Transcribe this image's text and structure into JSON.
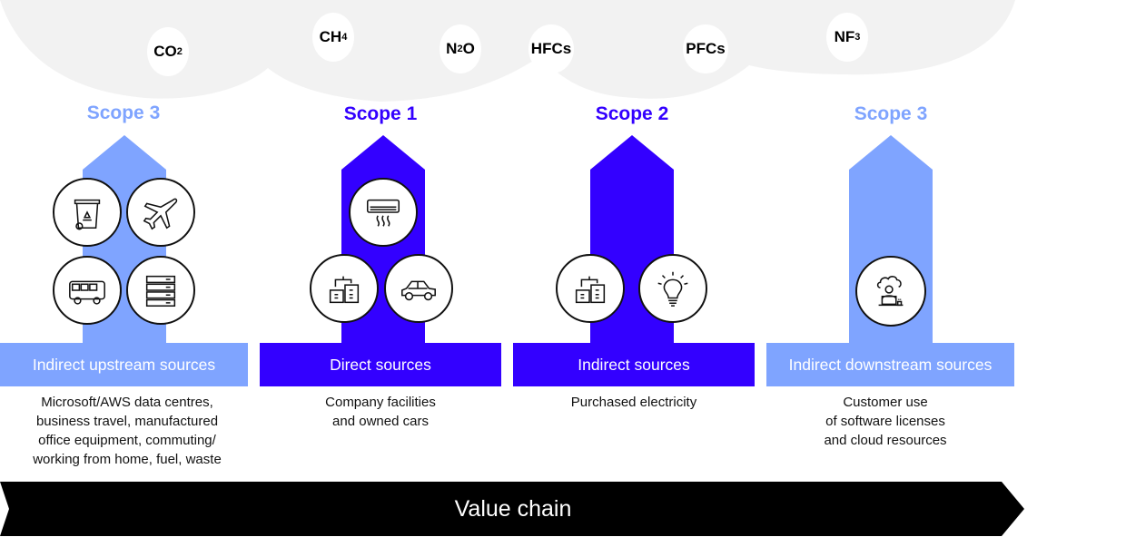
{
  "colors": {
    "scope_light": "#7fa4ff",
    "scope_dark": "#3300ff",
    "cloud": "#f2f2f2",
    "value_chain": "#000000"
  },
  "gases": [
    {
      "base": "CO",
      "sub": "2"
    },
    {
      "base": "CH",
      "sub": "4"
    },
    {
      "base": "N",
      "sub": "2",
      "tail": "O"
    },
    {
      "base": "HFCs",
      "sub": ""
    },
    {
      "base": "PFCs",
      "sub": ""
    },
    {
      "base": "NF",
      "sub": "3"
    }
  ],
  "scopes": [
    {
      "title": "Scope 3",
      "source_label": "Indirect upstream sources",
      "description": "Microsoft/AWS data centres,\nbusiness travel, manufactured\noffice equipment, commuting/\nworking from home, fuel, waste",
      "icons": [
        "recycling-bin-icon",
        "airplane-icon",
        "bus-icon",
        "server-rack-icon"
      ]
    },
    {
      "title": "Scope 1",
      "source_label": "Direct sources",
      "description": "Company facilities\nand owned cars",
      "icons": [
        "air-conditioner-icon",
        "buildings-icon",
        "car-icon"
      ]
    },
    {
      "title": "Scope 2",
      "source_label": "Indirect sources",
      "description": "Purchased electricity",
      "icons": [
        "buildings-icon",
        "lightbulb-icon"
      ]
    },
    {
      "title": "Scope 3",
      "source_label": "Indirect downstream sources",
      "description": "Customer use\nof software licenses\nand cloud resources",
      "icons": [
        "cloud-user-laptop-icon"
      ]
    }
  ],
  "value_chain": {
    "label": "Value chain"
  }
}
